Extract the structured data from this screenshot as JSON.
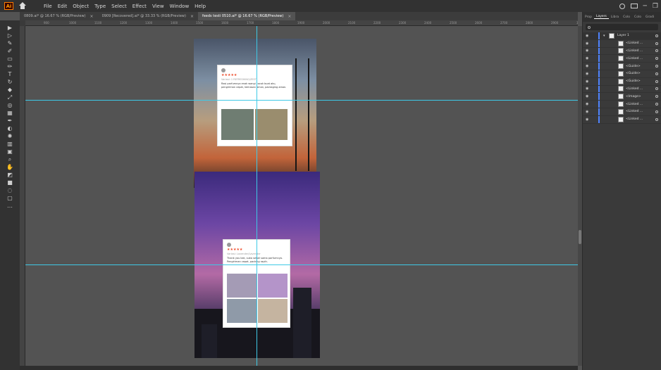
{
  "menu": {
    "items": [
      "File",
      "Edit",
      "Object",
      "Type",
      "Select",
      "Effect",
      "View",
      "Window",
      "Help"
    ]
  },
  "tabs": [
    {
      "label": "0809.ai* @ 16.67 % (RGB/Preview)",
      "active": false
    },
    {
      "label": "0909 [Recovered].ai* @ 33.33 % (RGB/Preview)",
      "active": false
    },
    {
      "label": "feeds testi 0510.ai* @ 16.67 % (RGB/Preview)",
      "active": true
    }
  ],
  "tab_close": "×",
  "ruler_ticks": [
    "900",
    "1000",
    "1100",
    "1200",
    "1300",
    "1400",
    "1500",
    "1600",
    "1700",
    "1800",
    "1900",
    "2000",
    "2100",
    "2200",
    "2300",
    "2400",
    "2500",
    "2600",
    "2700",
    "2800",
    "2900",
    "3000"
  ],
  "artboard1_card": {
    "stars": "★★★★★",
    "variant": "Variasi: 1 REFRESHING/ZEST",
    "text": "Rasi parfumnya enak wangi cocok buat aku, pengiriman cepat, kemasan aman, packaging aman."
  },
  "artboard2_card": {
    "stars": "★★★★★",
    "variant": "Variasi: Lavender/Lavender",
    "text": "Thank you kak, suka sekali sama parfumnya. Pengiriman cepat, packing rapih."
  },
  "panel": {
    "tabs": [
      "Prop",
      "Layers",
      "Libra",
      "Colo",
      "Colo",
      "Gradi"
    ],
    "active_tab": "Layers",
    "layers": [
      {
        "name": "Layer 1",
        "top": true
      },
      {
        "name": "<Linked ...",
        "top": false
      },
      {
        "name": "<Linked ...",
        "top": false
      },
      {
        "name": "<Linked ...",
        "top": false
      },
      {
        "name": "<Guide>",
        "top": false
      },
      {
        "name": "<Guide>",
        "top": false
      },
      {
        "name": "<Guide>",
        "top": false
      },
      {
        "name": "<Linked ...",
        "top": false
      },
      {
        "name": "<Image>",
        "top": false
      },
      {
        "name": "<Linked ...",
        "top": false
      },
      {
        "name": "<Linked ...",
        "top": false
      },
      {
        "name": "<Linked ...",
        "top": false
      }
    ]
  },
  "colors": {
    "guide": "#3ec9e6",
    "layer_color": "#4f83ff",
    "star": "#ee4d2d"
  }
}
